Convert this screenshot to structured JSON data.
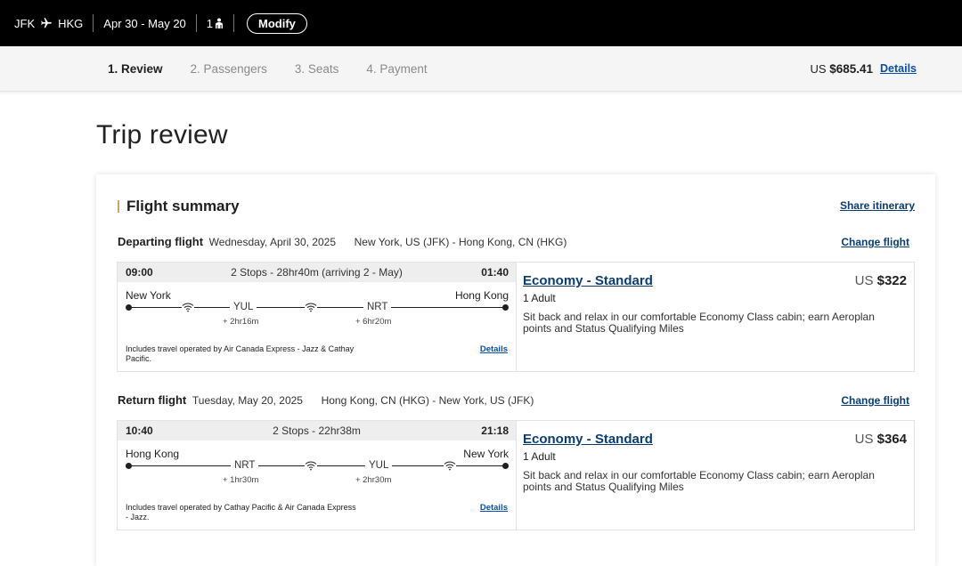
{
  "topbar": {
    "origin": "JFK",
    "destination": "HKG",
    "dates": "Apr 30 - May 20",
    "passengers": "1",
    "modify_label": "Modify"
  },
  "steps": [
    "1. Review",
    "2. Passengers",
    "3. Seats",
    "4. Payment"
  ],
  "total": {
    "currency": "US",
    "amount": "$685.41",
    "details_label": "Details"
  },
  "page_title": "Trip review",
  "summary": {
    "title": "Flight summary",
    "share_label": "Share itinerary",
    "change_label": "Change flight"
  },
  "departing": {
    "label": "Departing flight",
    "date": "Wednesday, April 30, 2025",
    "cities": "New York, US (JFK) - Hong Kong, CN (HKG)",
    "dep_time": "09:00",
    "stops_summary": "2 Stops - 28hr40m (arriving 2 - May)",
    "arr_time": "01:40",
    "from_city": "New York",
    "to_city": "Hong Kong",
    "stop1": "YUL",
    "stop1_layover": "+ 2hr16m",
    "stop2": "NRT",
    "stop2_layover": "+ 6hr20m",
    "operated": "Includes travel operated by Air Canada Express - Jazz & Cathay Pacific.",
    "details_label": "Details",
    "fare": "Economy - Standard",
    "price_currency": "US",
    "price": "$322",
    "pax": "1 Adult",
    "fare_desc": "Sit back and relax in our comfortable Economy Class cabin; earn Aeroplan points and Status Qualifying Miles"
  },
  "return": {
    "label": "Return flight",
    "date": "Tuesday, May 20, 2025",
    "cities": "Hong Kong, CN (HKG) - New York, US (JFK)",
    "dep_time": "10:40",
    "stops_summary": "2 Stops - 22hr38m",
    "arr_time": "21:18",
    "from_city": "Hong Kong",
    "to_city": "New York",
    "stop1": "NRT",
    "stop1_layover": "+ 1hr30m",
    "stop2": "YUL",
    "stop2_layover": "+ 2hr30m",
    "operated": "Includes travel operated by Cathay Pacific & Air Canada Express - Jazz.",
    "details_label": "Details",
    "fare": "Economy - Standard",
    "price_currency": "US",
    "price": "$364",
    "pax": "1 Adult",
    "fare_desc": "Sit back and relax in our comfortable Economy Class cabin; earn Aeroplan points and Status Qualifying Miles"
  },
  "icons": {
    "plane": "plane-icon",
    "person": "person-icon",
    "wifi": "wifi-icon"
  },
  "colors": {
    "topbar": "#000000",
    "link": "#0b3d72",
    "accent_bar": "#c8a56a"
  }
}
